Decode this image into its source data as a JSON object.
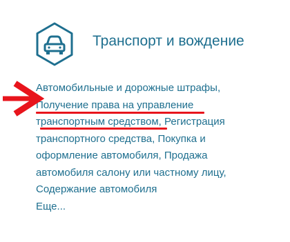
{
  "category": {
    "title": "Транспорт и вождение",
    "icon": "car-icon",
    "accent_color": "#1e6f8f"
  },
  "links": [
    {
      "label": "Автомобильные и дорожные штрафы"
    },
    {
      "label": "Получение права на управление транспортным средством",
      "highlighted": true
    },
    {
      "label": "Регистрация транспортного средства"
    },
    {
      "label": "Покупка и оформление автомобиля"
    },
    {
      "label": "Продажа автомобиля салону или частному лицу"
    },
    {
      "label": "Содержание автомобиля"
    }
  ],
  "separator": ",",
  "more_label": "Еще...",
  "annotation": {
    "arrow_icon": "red-arrow-icon",
    "underline_color": "#e8141c"
  }
}
